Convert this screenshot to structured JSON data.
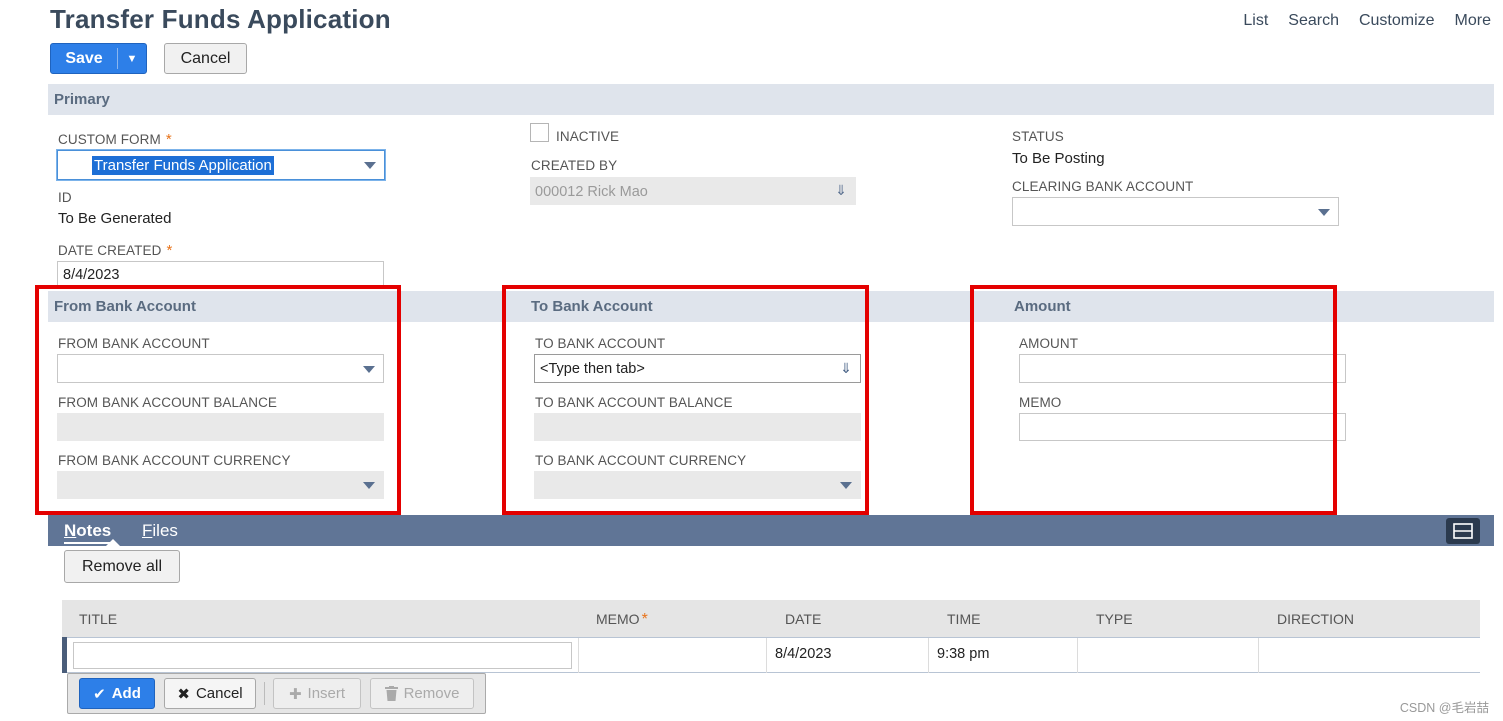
{
  "header": {
    "title": "Transfer Funds Application",
    "links": [
      "List",
      "Search",
      "Customize",
      "More"
    ]
  },
  "toolbar": {
    "save_label": "Save",
    "cancel_label": "Cancel"
  },
  "primary": {
    "section_title": "Primary",
    "custom_form": {
      "label": "CUSTOM FORM",
      "required": "*",
      "value": "Transfer Funds Application"
    },
    "id": {
      "label": "ID",
      "value": "To Be Generated"
    },
    "date_created": {
      "label": "DATE CREATED",
      "required": "*",
      "value": "8/4/2023"
    },
    "inactive": {
      "label": "INACTIVE",
      "checked": false
    },
    "created_by": {
      "label": "CREATED BY",
      "value": "000012 Rick Mao"
    },
    "status": {
      "label": "STATUS",
      "value": "To Be Posting"
    },
    "clearing_bank_account": {
      "label": "CLEARING BANK ACCOUNT",
      "value": ""
    }
  },
  "from_bank": {
    "section_title": "From Bank Account",
    "account_label": "FROM BANK ACCOUNT",
    "balance_label": "FROM BANK ACCOUNT BALANCE",
    "currency_label": "FROM BANK ACCOUNT CURRENCY"
  },
  "to_bank": {
    "section_title": "To Bank Account",
    "account_label": "TO BANK ACCOUNT",
    "account_value": "<Type then tab>",
    "balance_label": "TO BANK ACCOUNT BALANCE",
    "currency_label": "TO BANK ACCOUNT CURRENCY"
  },
  "amount": {
    "section_title": "Amount",
    "amount_label": "AMOUNT",
    "memo_label": "MEMO"
  },
  "subtabs": {
    "notes_first": "N",
    "notes_rest": "otes",
    "files_first": "F",
    "files_rest": "iles"
  },
  "notes": {
    "remove_all_label": "Remove all",
    "columns": [
      "TITLE",
      "MEMO",
      "DATE",
      "TIME",
      "TYPE",
      "DIRECTION"
    ],
    "memo_required": "*",
    "row": {
      "title": "",
      "memo": "",
      "date": "8/4/2023",
      "time": "9:38 pm",
      "type": "",
      "direction": ""
    },
    "actions": {
      "add": "Add",
      "cancel": "Cancel",
      "insert": "Insert",
      "remove": "Remove"
    }
  },
  "watermark": "CSDN @毛岩喆",
  "colors": {
    "primary_blue": "#2d7fe8",
    "section_bar": "#dfe4ec",
    "tabs_bar": "#607596",
    "highlight_red": "#e40000",
    "required_orange": "#e8731a"
  }
}
